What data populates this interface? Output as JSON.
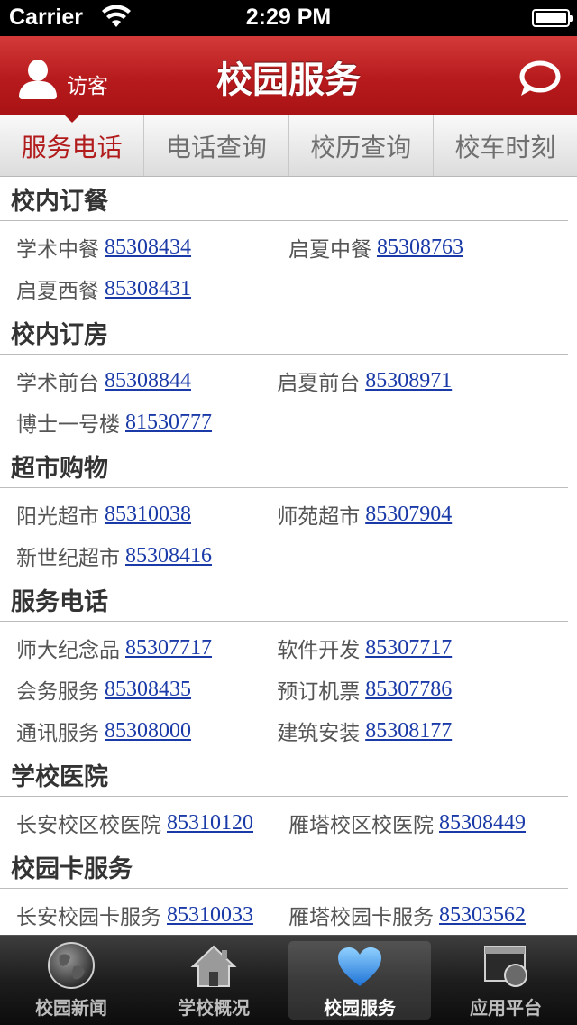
{
  "status_bar": {
    "carrier": "Carrier",
    "time": "2:29 PM"
  },
  "nav_bar": {
    "guest_label": "访客",
    "title": "校园服务"
  },
  "tabs": [
    {
      "label": "服务电话",
      "active": true
    },
    {
      "label": "电话查询",
      "active": false
    },
    {
      "label": "校历查询",
      "active": false
    },
    {
      "label": "校车时刻",
      "active": false
    }
  ],
  "sections": [
    {
      "title": "校内订餐",
      "entries": [
        {
          "name": "学术中餐",
          "phone": "85308434"
        },
        {
          "name": "启夏中餐",
          "phone": "85308763"
        },
        {
          "name": "启夏西餐",
          "phone": "85308431"
        }
      ]
    },
    {
      "title": "校内订房",
      "entries": [
        {
          "name": "学术前台",
          "phone": "85308844"
        },
        {
          "name": "启夏前台",
          "phone": "85308971"
        },
        {
          "name": "博士一号楼",
          "phone": "81530777"
        }
      ]
    },
    {
      "title": "超市购物",
      "entries": [
        {
          "name": "阳光超市",
          "phone": "85310038"
        },
        {
          "name": "师苑超市",
          "phone": "85307904"
        },
        {
          "name": "新世纪超市",
          "phone": "85308416"
        }
      ]
    },
    {
      "title": "服务电话",
      "entries": [
        {
          "name": "师大纪念品",
          "phone": "85307717"
        },
        {
          "name": "软件开发",
          "phone": "85307717"
        },
        {
          "name": "会务服务",
          "phone": "85308435"
        },
        {
          "name": "预订机票",
          "phone": "85307786"
        },
        {
          "name": "通讯服务",
          "phone": "85308000"
        },
        {
          "name": "建筑安装",
          "phone": "85308177"
        }
      ]
    },
    {
      "title": "学校医院",
      "entries": [
        {
          "name": "长安校区校医院",
          "phone": "85310120"
        },
        {
          "name": "雁塔校区校医院",
          "phone": "85308449"
        }
      ]
    },
    {
      "title": "校园卡服务",
      "entries": [
        {
          "name": "长安校园卡服务",
          "phone": "85310033"
        },
        {
          "name": "雁塔校园卡服务",
          "phone": "85303562"
        }
      ]
    }
  ],
  "tab_bar": [
    {
      "label": "校园新闻",
      "icon": "globe-icon",
      "active": false
    },
    {
      "label": "学校概况",
      "icon": "home-icon",
      "active": false
    },
    {
      "label": "校园服务",
      "icon": "heart-icon",
      "active": true
    },
    {
      "label": "应用平台",
      "icon": "app-window-icon",
      "active": false
    }
  ],
  "colors": {
    "nav_red": "#b71a1c",
    "link_blue": "#1a3aa8",
    "active_tab": "#b21b1c"
  }
}
